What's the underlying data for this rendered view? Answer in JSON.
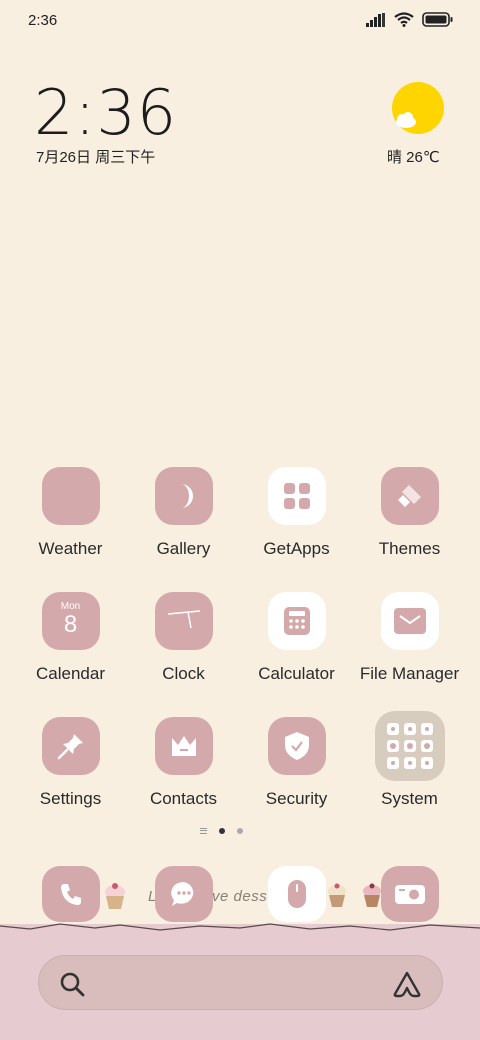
{
  "status_bar": {
    "time": "2:36"
  },
  "clock_widget": {
    "time": "2:36",
    "date": "7月26日 周三下午"
  },
  "weather_widget": {
    "text": "晴 26℃"
  },
  "apps": [
    {
      "label": "Weather"
    },
    {
      "label": "Gallery"
    },
    {
      "label": "GetApps"
    },
    {
      "label": "Themes"
    },
    {
      "label": "Calendar",
      "day_name": "Mon",
      "day_number": "8"
    },
    {
      "label": "Clock"
    },
    {
      "label": "Calculator"
    },
    {
      "label": "File Manager"
    },
    {
      "label": "Settings"
    },
    {
      "label": "Contacts"
    },
    {
      "label": "Security"
    },
    {
      "label": "System"
    }
  ],
  "dock": {
    "decor_text_left": "L",
    "decor_text_right": "ve dess"
  },
  "search": {
    "placeholder": ""
  },
  "colors": {
    "background": "#f8efe1",
    "icon_pink": "#d4a9ab",
    "dock_pink": "#e6ccd0",
    "sun": "#ffd500"
  },
  "icons": [
    "signal-icon",
    "wifi-icon",
    "battery-icon",
    "sun-cloud-icon",
    "moon-icon",
    "grid-icon",
    "brush-icon",
    "clock-hand-icon",
    "calculator-icon",
    "folder-icon",
    "pin-icon",
    "crown-icon",
    "shield-icon",
    "phone-icon",
    "message-icon",
    "mouse-icon",
    "camera-icon",
    "search-icon",
    "app-vault-icon"
  ]
}
